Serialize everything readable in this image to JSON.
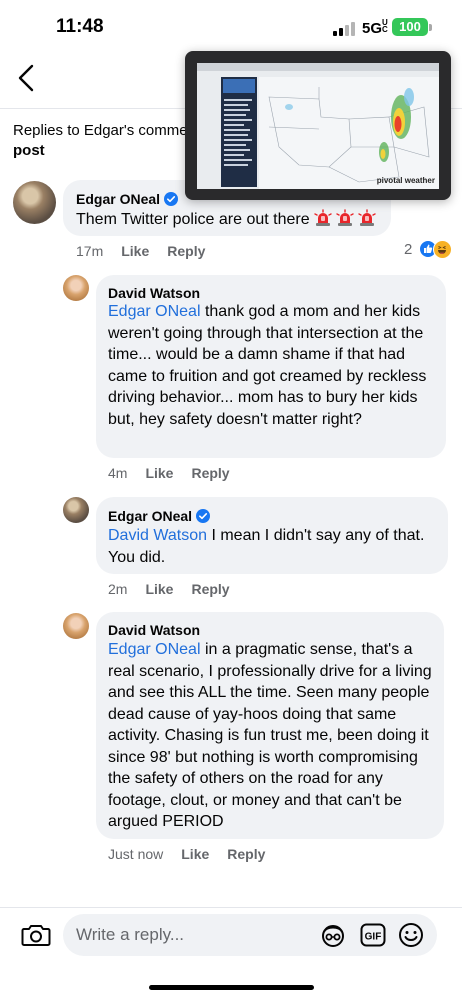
{
  "status_bar": {
    "time": "11:48",
    "network": "5G",
    "network_suffix": "UC",
    "battery": "100"
  },
  "header": {
    "title_line1": "Replies to Edgar's comment",
    "title_line2": "post"
  },
  "pip_video": {
    "brand": "pivotal weather"
  },
  "comments": [
    {
      "author": "Edgar ONeal",
      "verified": true,
      "text": "Them Twitter police are out there",
      "emoji": "police-siren x3",
      "time": "17m",
      "like_label": "Like",
      "reply_label": "Reply",
      "reaction_count": "2",
      "reactions": [
        "like",
        "haha"
      ]
    },
    {
      "author": "David Watson",
      "mention": "Edgar ONeal",
      "text": " thank god a mom and her kids weren't going through that intersection at the time... would be a damn shame if that had came to fruition and got creamed by reckless driving behavior... mom has to bury her kids but, hey safety doesn't matter right?",
      "time": "4m",
      "like_label": "Like",
      "reply_label": "Reply"
    },
    {
      "author": "Edgar ONeal",
      "verified": true,
      "mention": "David Watson",
      "text": " I mean I didn't say any of that. You did.",
      "time": "2m",
      "like_label": "Like",
      "reply_label": "Reply"
    },
    {
      "author": "David Watson",
      "mention": "Edgar ONeal",
      "text": " in a pragmatic sense, that's a real scenario, I professionally drive for a living and see this ALL the time. Seen many people dead cause of yay-hoos doing that same activity. Chasing is fun trust me, been doing it since 98' but nothing is worth compromising the safety of others on the road for any footage, clout, or money and that can't be argued PERIOD",
      "time": "Just now",
      "like_label": "Like",
      "reply_label": "Reply"
    }
  ],
  "composer": {
    "placeholder": "Write a reply..."
  },
  "colors": {
    "link_blue": "#216fdb",
    "bubble_bg": "#f0f2f5",
    "meta_gray": "#65676b",
    "battery_green": "#34c759"
  }
}
